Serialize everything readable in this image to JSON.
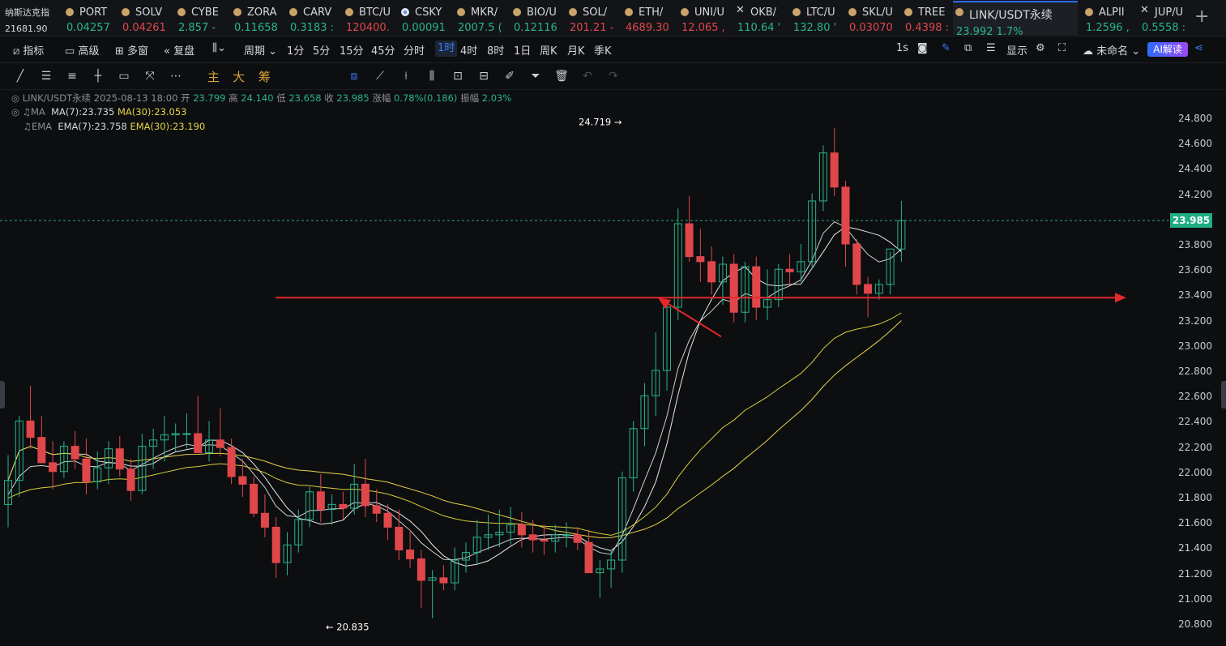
{
  "index": {
    "name": "纳斯达克指",
    "value": "21681.90"
  },
  "tickers": [
    {
      "sym": "PORT",
      "price": "0.04257",
      "dir": "up",
      "icon": "coin-dot"
    },
    {
      "sym": "SOLV",
      "price": "0.04261",
      "dir": "dn",
      "icon": "coin-dot"
    },
    {
      "sym": "CYBE",
      "price": "2.857 -",
      "dir": "up",
      "icon": "coin-dot"
    },
    {
      "sym": "ZORA",
      "price": "0.11658",
      "dir": "up",
      "icon": "coin-dot"
    },
    {
      "sym": "CARV",
      "price": "0.3183 :",
      "dir": "up",
      "icon": "coin-dot"
    },
    {
      "sym": "BTC/U",
      "price": "120400.",
      "dir": "dn",
      "icon": "coin-dot"
    },
    {
      "sym": "CSKY",
      "price": "0.00091",
      "dir": "up",
      "icon": "coin-dot-blue"
    },
    {
      "sym": "MKR/",
      "price": "2007.5 (",
      "dir": "up",
      "icon": "coin-dot"
    },
    {
      "sym": "BIO/U",
      "price": "0.12116",
      "dir": "up",
      "icon": "coin-dot"
    },
    {
      "sym": "SOL/",
      "price": "201.21 -",
      "dir": "dn",
      "icon": "coin-dot"
    },
    {
      "sym": "ETH/",
      "price": "4689.30",
      "dir": "dn",
      "icon": "coin-dot"
    },
    {
      "sym": "UNI/U",
      "price": "12.065 ,",
      "dir": "dn",
      "icon": "coin-dot"
    },
    {
      "sym": "OKB/",
      "price": "110.64 '",
      "dir": "up",
      "icon": "close-x"
    },
    {
      "sym": "LTC/U",
      "price": "132.80 '",
      "dir": "up",
      "icon": "coin-dot"
    },
    {
      "sym": "SKL/U",
      "price": "0.03070",
      "dir": "dn",
      "icon": "coin-dot"
    },
    {
      "sym": "TREE",
      "price": "0.4398 :",
      "dir": "dn",
      "icon": "coin-dot"
    },
    {
      "sym": "LINK/USDT永续",
      "price": "23.992  1.7%",
      "dir": "up",
      "icon": "coin-dot",
      "active": true
    },
    {
      "sym": "ALPII",
      "price": "1.2596 ,",
      "dir": "up",
      "icon": "coin-dot"
    },
    {
      "sym": "JUP/U",
      "price": "0.5558 :",
      "dir": "up",
      "icon": "close-x"
    }
  ],
  "toolbar": {
    "indicators": "指标",
    "advanced": "高级",
    "multiwin": "多窗",
    "replay": "复盘",
    "period": "周期",
    "intervals": [
      "1分",
      "5分",
      "15分",
      "45分",
      "分时",
      "1时",
      "4时",
      "8时",
      "1日",
      "周K",
      "月K",
      "季K"
    ],
    "active_interval": "1时",
    "refresh": "1s",
    "display": "显示",
    "unnamed": "未命名",
    "ai": "AI解读"
  },
  "drawing_tools": {
    "main": "主",
    "large": "大",
    "chip": "筹"
  },
  "legend": {
    "pair": "LINK/USDT永续",
    "time": "2025-08-13 18:00",
    "open_label": "开",
    "open": "23.799",
    "high_label": "高",
    "high": "24.140",
    "low_label": "低",
    "low": "23.658",
    "close_label": "收",
    "close": "23.985",
    "change_label": "涨幅",
    "change": "0.78%(0.186)",
    "amp_label": "振幅",
    "amp": "2.03%",
    "ma_tag": "MA",
    "ma7": "MA(7):23.735",
    "ma30": "MA(30):23.053",
    "ema_tag": "EMA",
    "ema7": "EMA(7):23.758",
    "ema30": "EMA(30):23.190"
  },
  "price_axis": [
    "24.800",
    "24.600",
    "24.400",
    "24.200",
    "24.000",
    "23.800",
    "23.600",
    "23.400",
    "23.200",
    "23.000",
    "22.800",
    "22.600",
    "22.400",
    "22.200",
    "22.000",
    "21.800",
    "21.600",
    "21.400",
    "21.200",
    "21.000",
    "20.800"
  ],
  "current_price": "23.985",
  "chart_data": {
    "type": "candlestick",
    "ylim": [
      20.78,
      24.92
    ],
    "high_marker": "24.719",
    "low_marker": "20.835",
    "horizontal_line": 23.375,
    "colors": {
      "up": "#28b58c",
      "down": "#e0474b",
      "ma7": "#e8e8e8",
      "ma30": "#e6d44a",
      "annotation": "#e22a2a"
    },
    "candles": [
      [
        21.74,
        22.13,
        21.56,
        21.93
      ],
      [
        21.93,
        22.44,
        21.8,
        22.4
      ],
      [
        22.4,
        22.68,
        22.18,
        22.27
      ],
      [
        22.27,
        22.44,
        22.09,
        22.07
      ],
      [
        22.07,
        22.24,
        21.86,
        22.0
      ],
      [
        22.0,
        22.24,
        21.95,
        22.2
      ],
      [
        22.2,
        22.32,
        22.02,
        22.1
      ],
      [
        22.1,
        22.26,
        21.82,
        21.92
      ],
      [
        21.92,
        22.16,
        21.86,
        22.03
      ],
      [
        22.03,
        22.24,
        21.9,
        22.18
      ],
      [
        22.18,
        22.28,
        21.96,
        22.02
      ],
      [
        22.02,
        22.1,
        21.77,
        21.85
      ],
      [
        21.85,
        22.3,
        21.82,
        22.2
      ],
      [
        22.2,
        22.34,
        22.02,
        22.25
      ],
      [
        22.25,
        22.44,
        22.08,
        22.29
      ],
      [
        22.29,
        22.38,
        22.16,
        22.3
      ],
      [
        22.3,
        22.46,
        22.18,
        22.3
      ],
      [
        22.3,
        22.6,
        22.18,
        22.15
      ],
      [
        22.15,
        22.4,
        22.08,
        22.25
      ],
      [
        22.25,
        22.5,
        22.12,
        22.19
      ],
      [
        22.19,
        22.26,
        21.9,
        21.96
      ],
      [
        21.96,
        22.1,
        21.8,
        21.9
      ],
      [
        21.9,
        21.96,
        21.64,
        21.67
      ],
      [
        21.67,
        21.82,
        21.48,
        21.56
      ],
      [
        21.56,
        21.64,
        21.16,
        21.28
      ],
      [
        21.28,
        21.52,
        21.18,
        21.42
      ],
      [
        21.42,
        21.7,
        21.36,
        21.62
      ],
      [
        21.62,
        21.88,
        21.56,
        21.84
      ],
      [
        21.84,
        21.98,
        21.6,
        21.7
      ],
      [
        21.7,
        21.82,
        21.58,
        21.74
      ],
      [
        21.74,
        21.84,
        21.62,
        21.71
      ],
      [
        21.71,
        22.06,
        21.66,
        21.9
      ],
      [
        21.9,
        22.1,
        21.64,
        21.73
      ],
      [
        21.73,
        21.86,
        21.6,
        21.67
      ],
      [
        21.67,
        21.74,
        21.46,
        21.56
      ],
      [
        21.56,
        21.7,
        21.3,
        21.38
      ],
      [
        21.38,
        21.54,
        21.24,
        21.31
      ],
      [
        21.31,
        21.38,
        20.92,
        21.14
      ],
      [
        21.14,
        21.22,
        20.84,
        21.16
      ],
      [
        21.16,
        21.26,
        21.06,
        21.12
      ],
      [
        21.12,
        21.4,
        21.06,
        21.3
      ],
      [
        21.3,
        21.44,
        21.2,
        21.36
      ],
      [
        21.36,
        21.62,
        21.26,
        21.48
      ],
      [
        21.48,
        21.66,
        21.38,
        21.5
      ],
      [
        21.5,
        21.7,
        21.4,
        21.52
      ],
      [
        21.52,
        21.72,
        21.42,
        21.58
      ],
      [
        21.58,
        21.68,
        21.4,
        21.5
      ],
      [
        21.5,
        21.62,
        21.36,
        21.46
      ],
      [
        21.46,
        21.58,
        21.34,
        21.45
      ],
      [
        21.45,
        21.58,
        21.36,
        21.5
      ],
      [
        21.5,
        21.6,
        21.4,
        21.5
      ],
      [
        21.5,
        21.56,
        21.38,
        21.44
      ],
      [
        21.44,
        21.54,
        21.2,
        21.2
      ],
      [
        21.2,
        21.3,
        21.0,
        21.23
      ],
      [
        21.23,
        21.38,
        21.08,
        21.3
      ],
      [
        21.3,
        22.0,
        21.2,
        21.95
      ],
      [
        21.95,
        22.4,
        21.84,
        22.34
      ],
      [
        22.34,
        22.7,
        22.2,
        22.6
      ],
      [
        22.6,
        23.1,
        22.44,
        22.8
      ],
      [
        22.8,
        23.36,
        22.64,
        23.3
      ],
      [
        23.3,
        24.08,
        23.2,
        23.96
      ],
      [
        23.96,
        24.18,
        23.66,
        23.7
      ],
      [
        23.7,
        23.92,
        23.5,
        23.66
      ],
      [
        23.66,
        23.78,
        23.4,
        23.5
      ],
      [
        23.5,
        23.7,
        23.32,
        23.64
      ],
      [
        23.64,
        23.72,
        23.18,
        23.26
      ],
      [
        23.26,
        23.66,
        23.18,
        23.62
      ],
      [
        23.62,
        23.7,
        23.2,
        23.3
      ],
      [
        23.3,
        23.6,
        23.2,
        23.36
      ],
      [
        23.36,
        23.64,
        23.3,
        23.6
      ],
      [
        23.6,
        23.72,
        23.48,
        23.58
      ],
      [
        23.58,
        23.8,
        23.5,
        23.66
      ],
      [
        23.66,
        24.2,
        23.6,
        24.14
      ],
      [
        24.14,
        24.58,
        24.06,
        24.52
      ],
      [
        24.52,
        24.72,
        24.18,
        24.25
      ],
      [
        24.25,
        24.3,
        23.62,
        23.8
      ],
      [
        23.8,
        23.84,
        23.4,
        23.48
      ],
      [
        23.48,
        23.54,
        23.22,
        23.41
      ],
      [
        23.41,
        23.52,
        23.36,
        23.48
      ],
      [
        23.48,
        23.74,
        23.4,
        23.76
      ],
      [
        23.76,
        24.14,
        23.66,
        23.985
      ]
    ]
  }
}
